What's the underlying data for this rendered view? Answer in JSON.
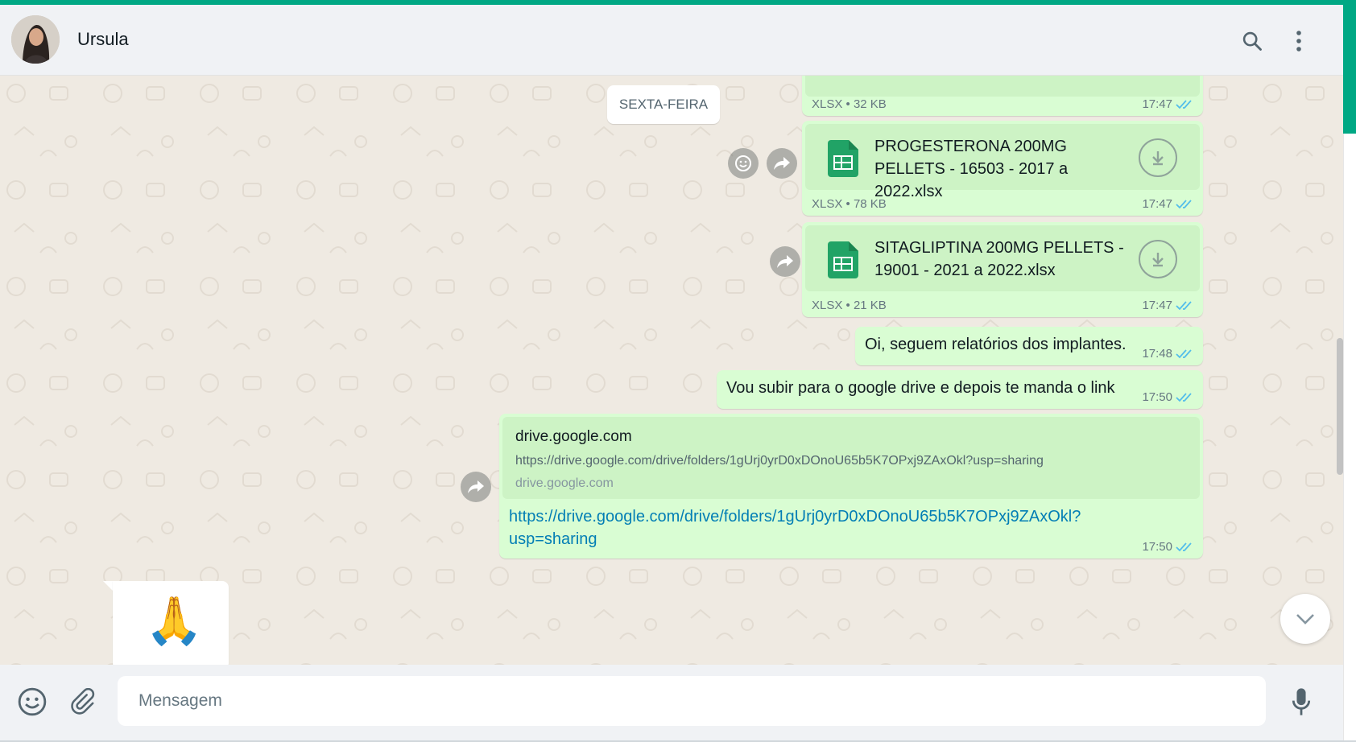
{
  "contact": {
    "name": "Ursula"
  },
  "date_separator": "SEXTA-FEIRA",
  "messages": {
    "m0": {
      "type": "XLSX",
      "size": "32 KB",
      "time": "17:47"
    },
    "m1": {
      "filename": "PROGESTERONA 200MG PELLETS - 16503 - 2017 a 2022.xlsx",
      "type": "XLSX",
      "size": "78 KB",
      "time": "17:47"
    },
    "m2": {
      "filename": "SITAGLIPTINA 200MG PELLETS - 19001 - 2021 a 2022.xlsx",
      "type": "XLSX",
      "size": "21 KB",
      "time": "17:47"
    },
    "m3": {
      "text": "Oi, seguem relatórios dos implantes.",
      "time": "17:48"
    },
    "m4": {
      "text": "Vou subir para o google drive e depois te manda o link",
      "time": "17:50"
    },
    "m5": {
      "preview_title": "drive.google.com",
      "preview_url": "https://drive.google.com/drive/folders/1gUrj0yrD0xDOnoU65b5K7OPxj9ZAxOkl?usp=sharing",
      "preview_domain": "drive.google.com",
      "link_line1": "https://drive.google.com/drive/folders/1gUrj0yrD0xDOnoU65b5K7OPxj9ZAxOkl?",
      "link_line2": "usp=sharing",
      "time": "17:50"
    },
    "m6": {
      "emoji": "🙏"
    }
  },
  "composer": {
    "placeholder": "Mensagem"
  },
  "icons": {
    "search": "search-icon",
    "menu": "menu-icon",
    "emoji": "emoji-icon",
    "attach": "attach-icon",
    "mic": "mic-icon",
    "forward": "forward-icon",
    "download": "download-icon",
    "react": "emoji-reaction-icon",
    "scroll_down": "chevron-down-icon",
    "spreadsheet": "spreadsheet-file-icon",
    "read_receipt": "double-check-icon"
  },
  "colors": {
    "accent": "#00a884",
    "outgoing": "#d9fdd3",
    "read_ticks": "#53bdeb",
    "link": "#027eb5"
  }
}
